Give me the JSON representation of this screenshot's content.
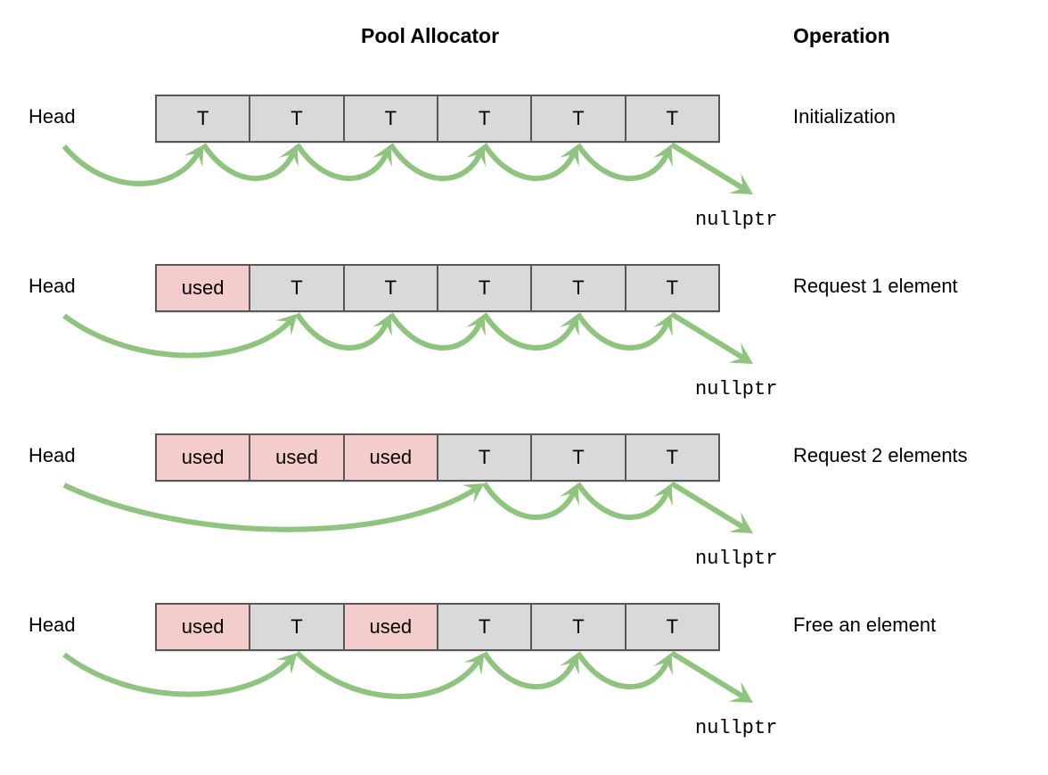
{
  "headers": {
    "pool": "Pool Allocator",
    "operation": "Operation"
  },
  "labels": {
    "head": "Head",
    "nullptr": "nullptr",
    "free_marker": "T",
    "used_marker": "used"
  },
  "colors": {
    "free_cell": "#d9d9d9",
    "used_cell": "#f4cccc",
    "cell_border": "#575757",
    "arrow": "#8fc47e",
    "text": "#000000",
    "background": "#ffffff"
  },
  "rows": [
    {
      "head": "Head",
      "operation": "Initialization",
      "nullptr": "nullptr",
      "cells": [
        {
          "label": "T",
          "state": "free"
        },
        {
          "label": "T",
          "state": "free"
        },
        {
          "label": "T",
          "state": "free"
        },
        {
          "label": "T",
          "state": "free"
        },
        {
          "label": "T",
          "state": "free"
        },
        {
          "label": "T",
          "state": "free"
        }
      ],
      "free_list_order": [
        0,
        1,
        2,
        3,
        4,
        5
      ]
    },
    {
      "head": "Head",
      "operation": "Request 1 element",
      "nullptr": "nullptr",
      "cells": [
        {
          "label": "used",
          "state": "used"
        },
        {
          "label": "T",
          "state": "free"
        },
        {
          "label": "T",
          "state": "free"
        },
        {
          "label": "T",
          "state": "free"
        },
        {
          "label": "T",
          "state": "free"
        },
        {
          "label": "T",
          "state": "free"
        }
      ],
      "free_list_order": [
        1,
        2,
        3,
        4,
        5
      ]
    },
    {
      "head": "Head",
      "operation": "Request 2 elements",
      "nullptr": "nullptr",
      "cells": [
        {
          "label": "used",
          "state": "used"
        },
        {
          "label": "used",
          "state": "used"
        },
        {
          "label": "used",
          "state": "used"
        },
        {
          "label": "T",
          "state": "free"
        },
        {
          "label": "T",
          "state": "free"
        },
        {
          "label": "T",
          "state": "free"
        }
      ],
      "free_list_order": [
        3,
        4,
        5
      ]
    },
    {
      "head": "Head",
      "operation": "Free an element",
      "nullptr": "nullptr",
      "cells": [
        {
          "label": "used",
          "state": "used"
        },
        {
          "label": "T",
          "state": "free"
        },
        {
          "label": "used",
          "state": "used"
        },
        {
          "label": "T",
          "state": "free"
        },
        {
          "label": "T",
          "state": "free"
        },
        {
          "label": "T",
          "state": "free"
        }
      ],
      "free_list_order": [
        1,
        3,
        4,
        5
      ]
    }
  ]
}
